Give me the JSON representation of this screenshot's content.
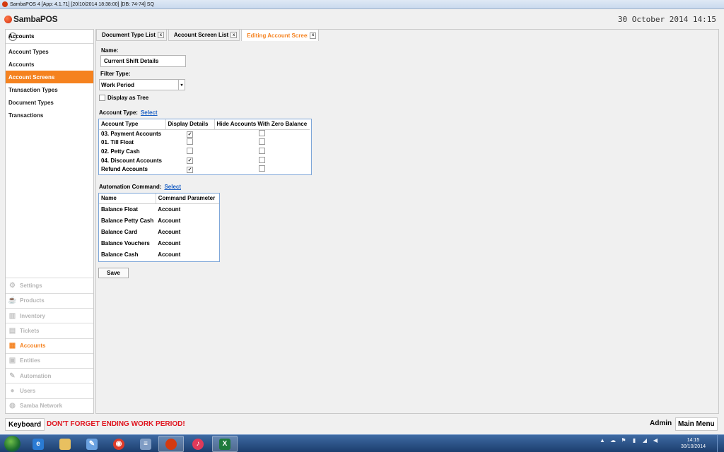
{
  "window": {
    "title": "SambaPOS 4 [App: 4.1.71] [20/10/2014 18:38:00] [DB: 74-74] SQ"
  },
  "header": {
    "logo": "SambaPOS",
    "datetime": "30 October 2014 14:15"
  },
  "sidebar": {
    "title": "Accounts",
    "items": [
      {
        "label": "Account Types"
      },
      {
        "label": "Accounts"
      },
      {
        "label": "Account Screens",
        "active": true
      },
      {
        "label": "Transaction Types"
      },
      {
        "label": "Document Types"
      },
      {
        "label": "Transactions"
      }
    ],
    "nav": [
      {
        "label": "Settings",
        "icon": "gear-icon"
      },
      {
        "label": "Products",
        "icon": "cup-icon"
      },
      {
        "label": "Inventory",
        "icon": "box-icon"
      },
      {
        "label": "Tickets",
        "icon": "tickets-icon"
      },
      {
        "label": "Accounts",
        "icon": "calculator-icon",
        "active": true
      },
      {
        "label": "Entities",
        "icon": "entities-icon"
      },
      {
        "label": "Automation",
        "icon": "pen-icon"
      },
      {
        "label": "Users",
        "icon": "user-icon"
      },
      {
        "label": "Samba Network",
        "icon": "globe-icon"
      }
    ]
  },
  "tabs": [
    {
      "label": "Document Type List",
      "close": "x"
    },
    {
      "label": "Account Screen List",
      "close": "x"
    },
    {
      "label": "Editing Account Screen",
      "close": "x",
      "active": true
    }
  ],
  "form": {
    "name_label": "Name:",
    "name_value": "Current Shift Details",
    "filter_label": "Filter Type:",
    "filter_value": "Work Period",
    "display_tree_label": "Display as Tree",
    "account_type_label": "Account Type:",
    "select_link": "Select",
    "account_types": {
      "headers": [
        "Account Type",
        "Display Details",
        "Hide Accounts With Zero Balance"
      ],
      "rows": [
        {
          "name": "03.  Payment Accounts",
          "display": true,
          "hide": false
        },
        {
          "name": "01.  Till Float",
          "display": false,
          "hide": false
        },
        {
          "name": "02.  Petty Cash",
          "display": false,
          "hide": false
        },
        {
          "name": "04.  Discount Accounts",
          "display": true,
          "hide": false
        },
        {
          "name": "Refund Accounts",
          "display": true,
          "hide": false
        }
      ]
    },
    "automation_label": "Automation Command:",
    "automation_select": "Select",
    "commands": {
      "headers": [
        "Name",
        "Command Parameter"
      ],
      "rows": [
        {
          "name": "Balance Float",
          "param": "Account"
        },
        {
          "name": "Balance Petty Cash",
          "param": "Account"
        },
        {
          "name": "Balance Card",
          "param": "Account"
        },
        {
          "name": "Balance Vouchers",
          "param": "Account"
        },
        {
          "name": "Balance Cash",
          "param": "Account"
        }
      ]
    },
    "save_label": "Save"
  },
  "bottom": {
    "keyboard": "Keyboard",
    "warning": "DON'T FORGET ENDING WORK PERIOD!",
    "user": "Admin",
    "main_menu": "Main Menu"
  },
  "taskbar": {
    "time": "14:15",
    "date": "30/10/2014"
  },
  "colors": {
    "accent": "#f5821f",
    "link": "#1a5fc4",
    "warning": "#e0141e"
  }
}
